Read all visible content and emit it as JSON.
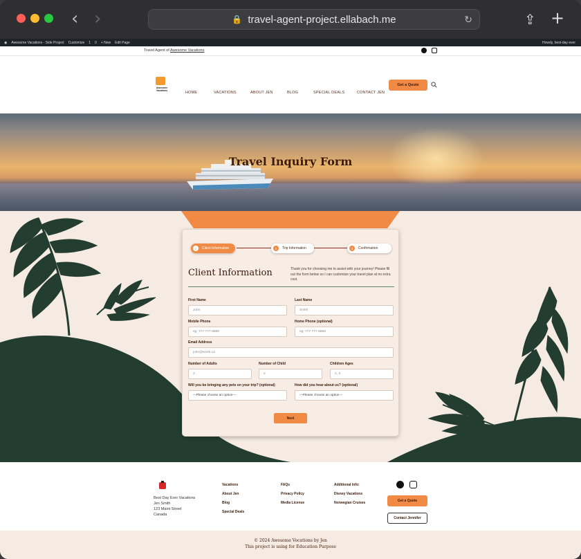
{
  "browser": {
    "url": "travel-agent-project.ellabach.me",
    "traffic_lights": [
      "#ff5f57",
      "#febc2e",
      "#28c840"
    ]
  },
  "admin_bar": {
    "items": [
      "Awesome Vacations - Side Project",
      "Customize",
      "1",
      "0",
      "+ New",
      "Edit Page"
    ],
    "greeting": "Howdy, best-day ever"
  },
  "topbar": {
    "prefix": "Travel Agent of ",
    "brand_link": "Awesome Vacations"
  },
  "header": {
    "logo_text": "Awesome Vacations",
    "nav": [
      "HOME",
      "VACATIONS",
      "ABOUT JEN",
      "BLOG",
      "SPECIAL DEALS",
      "CONTACT JEN"
    ],
    "cta": "Get a Quote"
  },
  "hero": {
    "title": "Travel Inquiry Form"
  },
  "form": {
    "steps": [
      {
        "num": "1",
        "label": "Client Information"
      },
      {
        "num": "2",
        "label": "Trip Information"
      },
      {
        "num": "3",
        "label": "Confirmation"
      }
    ],
    "title": "Client Information",
    "intro": "Thank you for choosing me to assist with your journey! Please fill out the form below so I can customize your travel plan at no extra cost.",
    "fields": {
      "first_name": {
        "label": "First Name",
        "placeholder": "John"
      },
      "last_name": {
        "label": "Last Name",
        "placeholder": "Smith"
      },
      "mobile": {
        "label": "Mobile Phone",
        "placeholder": "eg: 777-777-8888"
      },
      "home_phone": {
        "label": "Home Phone (optional)",
        "placeholder": "eg: 777-777-8888"
      },
      "email": {
        "label": "Email Address",
        "placeholder": "john@smith.ca"
      },
      "adults": {
        "label": "Number of Adults",
        "placeholder": "2"
      },
      "children": {
        "label": "Number of Child",
        "placeholder": "2"
      },
      "ages": {
        "label": "Children Ages",
        "placeholder": "2, 3"
      },
      "pets": {
        "label": "Will you be bringing any pets on your trip? (optional)",
        "value": "—Please choose an option—"
      },
      "hear": {
        "label": "How did you hear about us? (optional)",
        "value": "—Please choose an option—"
      }
    },
    "next": "Next"
  },
  "footer": {
    "address": [
      "Best Day Ever Vacations",
      "Jen Smith",
      "123 Maint Street",
      "Canada"
    ],
    "col1": [
      "Vacations",
      "About Jen",
      "Blog",
      "Special Deals"
    ],
    "col2": [
      "FAQs",
      "Privacy Policy",
      "Media License"
    ],
    "col3": [
      "Additional Info:",
      "Disney Vacations",
      "Norwegian Cruises"
    ],
    "quote": "Get a Quote",
    "contact": "Contact Jennifer",
    "copyright": "© 2024 Awesome Vocations by Jen",
    "note": "This project is using for Education Purpose"
  },
  "colors": {
    "accent": "#f08a45",
    "leaf": "#233d30",
    "background": "#f6ebe2",
    "text_dark": "#3a1a0a"
  }
}
